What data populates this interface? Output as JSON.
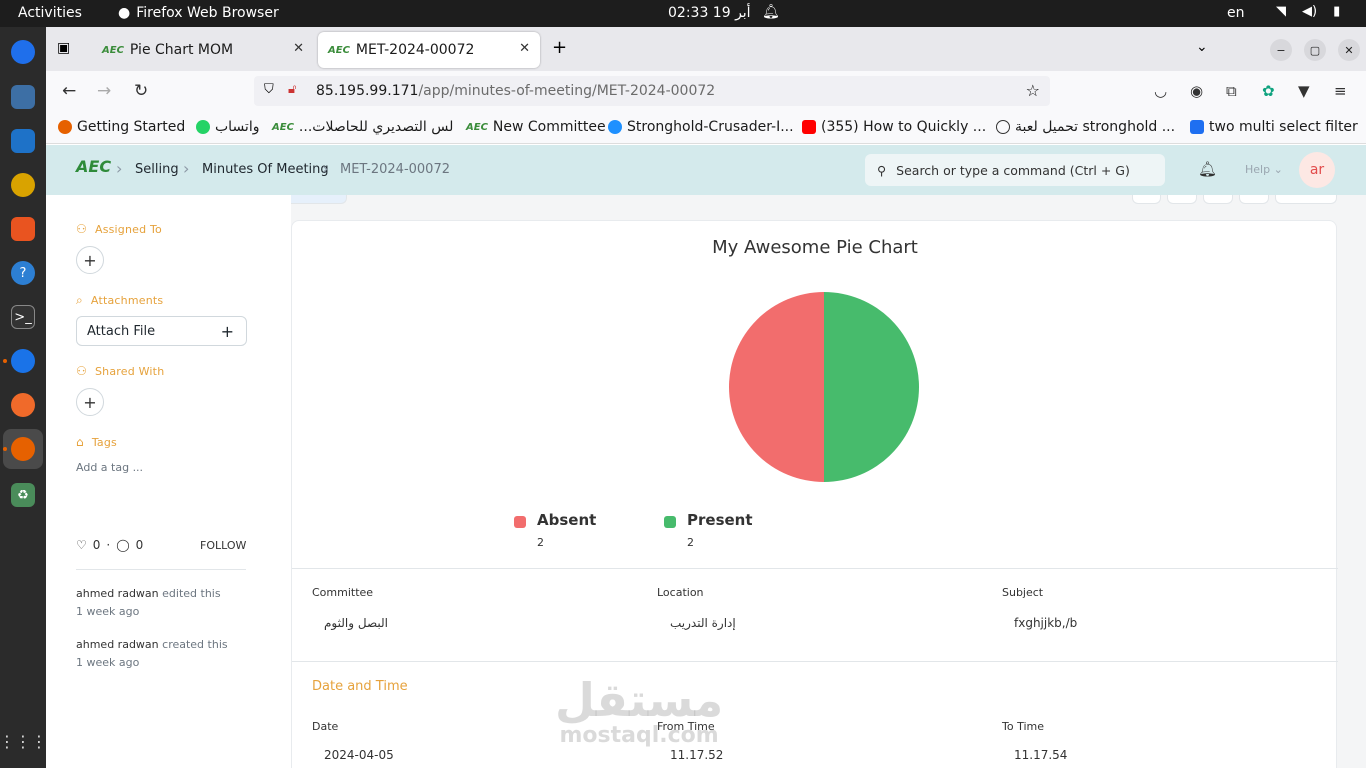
{
  "os": {
    "activities": "Activities",
    "app_name": "Firefox Web Browser",
    "clock": "02:33  19 أبر",
    "lang": "en"
  },
  "browser": {
    "tabs": [
      {
        "label": "Pie Chart MOM"
      },
      {
        "label": "MET-2024-00072"
      }
    ],
    "url_host": "85.195.99.171",
    "url_path": "/app/minutes-of-meeting/MET-2024-00072",
    "bookmarks": [
      {
        "label": "Getting Started"
      },
      {
        "label": "واتساب"
      },
      {
        "label": "...لس التصديري للحاصلات"
      },
      {
        "label": "New Committee"
      },
      {
        "label": "Stronghold-Crusader-I..."
      },
      {
        "label": "(355) How to Quickly ..."
      },
      {
        "label": "تحميل لعبة stronghold ..."
      },
      {
        "label": "two multi select filter"
      }
    ]
  },
  "app": {
    "logo": "AEC",
    "breadcrumbs": [
      "Selling",
      "Minutes Of Meeting",
      "MET-2024-00072"
    ],
    "search_placeholder": "Search or type a command (Ctrl + G)",
    "help": "Help",
    "avatar": "ar"
  },
  "sidebar": {
    "assigned_to": "Assigned To",
    "attachments": "Attachments",
    "attach_file": "Attach File",
    "shared_with": "Shared With",
    "tags": "Tags",
    "add_tag": "Add a tag ...",
    "likes": "0",
    "comments": "0",
    "follow": "FOLLOW",
    "activity": [
      {
        "user": "ahmed radwan",
        "action": "edited this",
        "time": "1 week ago"
      },
      {
        "user": "ahmed radwan",
        "action": "created this",
        "time": "1 week ago"
      }
    ]
  },
  "chart_data": {
    "type": "pie",
    "title": "My Awesome Pie Chart",
    "categories": [
      "Absent",
      "Present"
    ],
    "values": [
      2,
      2
    ],
    "colors": [
      "#f26d6d",
      "#47bb6c"
    ],
    "legend_placement": "bottom"
  },
  "fields": {
    "committee_label": "Committee",
    "committee_value": "البصل والثوم",
    "location_label": "Location",
    "location_value": "إدارة التدريب",
    "subject_label": "Subject",
    "subject_value": "fxghjjkb,/b",
    "section_title": "Date and Time",
    "date_label": "Date",
    "date_value": "2024-04-05",
    "from_label": "From Time",
    "from_value": "11.17.52",
    "to_label": "To Time",
    "to_value": "11.17.54"
  },
  "watermark": {
    "line1": "مستقل",
    "line2": "mostaql.com"
  }
}
